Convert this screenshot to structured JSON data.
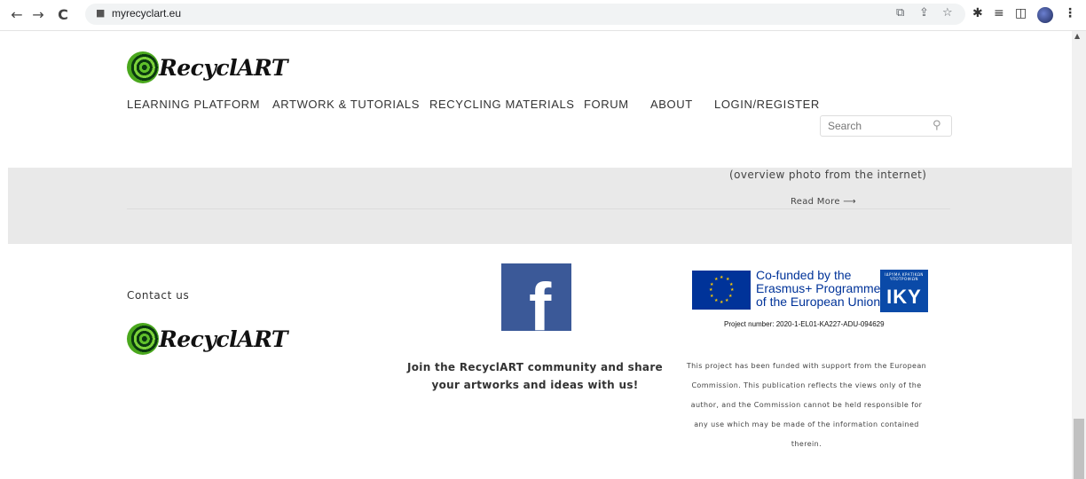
{
  "browser": {
    "url": "myrecyclart.eu",
    "back_icon": "←",
    "forward_icon": "→",
    "reload_icon": "C",
    "lock_icon": "🔒",
    "translate_icon": "⧉",
    "share_icon": "⇪",
    "star_icon": "☆",
    "extensions_icon": "✱",
    "media_icon": "≡",
    "sidepanel_icon": "◫",
    "menu_icon": "⋮"
  },
  "header": {
    "logo_text": "RecyclART",
    "menu": [
      {
        "label": "LEARNING PLATFORM"
      },
      {
        "label": "ARTWORK & TUTORIALS"
      },
      {
        "label": "RECYCLING MATERIALS"
      },
      {
        "label": "FORUM"
      },
      {
        "label": "ABOUT"
      },
      {
        "label": "LOGIN/REGISTER"
      }
    ],
    "search": {
      "placeholder": "Search",
      "icon": "🔍"
    }
  },
  "band": {
    "caption": "(overview photo from the internet)",
    "read_more": "Read More ⟶"
  },
  "footer": {
    "contact": "Contact us",
    "logo_text": "RecyclART",
    "facebook_letter": "f",
    "join_text_line1": "Join the RecyclART community and share",
    "join_text_line2": "your artworks and ideas with us!",
    "eu": {
      "line1": "Co-funded by the",
      "line2": "Erasmus+ Programme",
      "line3": "of the European Union",
      "iky_small": "ΙΔΡΥΜΑ ΚΡΑΤΙΚΩΝ ΥΠΟΤΡΟΦΙΩΝ",
      "iky": "IKY",
      "project_number": "Project number: 2020-1-EL01-KA227-ADU-094629"
    },
    "disclaimer": [
      "This project has been funded with support from the European",
      "Commission. This publication reflects the views only of the",
      "author, and the Commission cannot be held responsible for",
      "any use which may be made of the information contained",
      "therein."
    ]
  },
  "colors": {
    "band": "#e9e9e9",
    "facebook": "#3b5998",
    "eu_blue": "#003399",
    "eu_star": "#ffcc00"
  }
}
